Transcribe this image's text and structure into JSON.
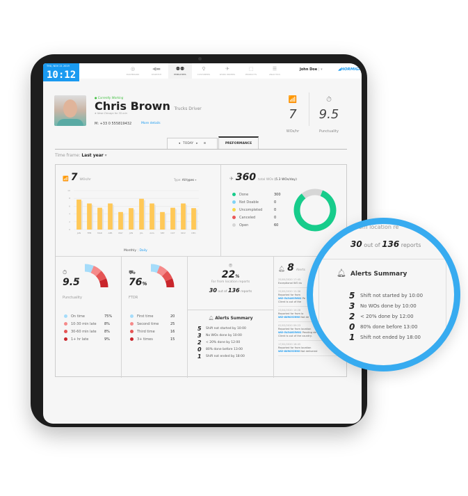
{
  "header": {
    "date": "THU, NOV 21 2019",
    "time": "10:12",
    "nav": [
      {
        "icon": "dashboard-icon",
        "glyph": "◎",
        "label": "DASHBOARD",
        "active": false
      },
      {
        "icon": "dispatch-icon",
        "glyph": "📢",
        "label": "DISPATCH",
        "active": false
      },
      {
        "icon": "employees-icon",
        "glyph": "👥",
        "label": "EMPLOYEES",
        "active": true
      },
      {
        "icon": "customers-icon",
        "glyph": "⚲",
        "label": "CUSTOMERS",
        "active": false
      },
      {
        "icon": "work-orders-icon",
        "glyph": "✈",
        "label": "WORK ORDERS",
        "active": false
      },
      {
        "icon": "products-icon",
        "glyph": "⬚",
        "label": "PRODUCTS",
        "active": false
      },
      {
        "icon": "analytics-icon",
        "glyph": "☰",
        "label": "ANALYTICS",
        "active": false
      }
    ],
    "user": "John Doe",
    "logo": "HORMIGA"
  },
  "profile": {
    "status": "Currently Working",
    "name": "Chris Brown",
    "role": "Trucks Driver",
    "location": "Near Chicago for 35 min",
    "phone": "M: +33 0 555819432",
    "more_details": "More details",
    "kpis": [
      {
        "icon": "growth-chart-icon",
        "value": "7",
        "label": "WOs/hr"
      },
      {
        "icon": "stopwatch-icon",
        "value": "9.5",
        "label": "Punctuality"
      }
    ]
  },
  "tabs": {
    "today": "TODAY",
    "performance": "PREFORMANCE"
  },
  "timeframe": {
    "label": "Time frame:",
    "value": "Last year"
  },
  "wos_per_hour": {
    "value": "7",
    "label": "WOs/hr",
    "type_label": "Type:",
    "type_value": "All types",
    "toggle": {
      "monthly": "Monthly",
      "daily": "Daily"
    }
  },
  "chart_data": {
    "type": "bar",
    "title": "WOs/hr",
    "categories": [
      "JAN",
      "FEB",
      "MAR",
      "APR",
      "MAY",
      "JUN",
      "JUL",
      "AUG",
      "SEP",
      "OCT",
      "NOV",
      "DEC"
    ],
    "values": [
      7.7,
      6.7,
      5.6,
      6.7,
      4.5,
      5.5,
      7.9,
      6.7,
      4.5,
      5.6,
      6.7,
      5.5
    ],
    "yticks": [
      0,
      2,
      4,
      6,
      8,
      10
    ],
    "ylim": [
      0,
      10
    ],
    "xlabel": "",
    "ylabel": "",
    "grid": true,
    "color": "#ffc857"
  },
  "total_wos": {
    "value": "360",
    "label": "total WOs",
    "rate": "(5.3 WOs/day)",
    "breakdown": [
      {
        "label": "Done",
        "value": 300,
        "color": "#17cc8b"
      },
      {
        "label": "Not Doable",
        "value": 0,
        "color": "#7fd3f5"
      },
      {
        "label": "Uncompleted",
        "value": 0,
        "color": "#f5d94a"
      },
      {
        "label": "Canceled",
        "value": 0,
        "color": "#e95757"
      },
      {
        "label": "Open",
        "value": 60,
        "color": "#d6d6d6"
      }
    ]
  },
  "punctuality": {
    "value": "9.5",
    "label": "Punctuality",
    "items": [
      {
        "label": "On time",
        "value": "75%",
        "color": "#a5dcfa"
      },
      {
        "label": "10-30 min late",
        "value": "8%",
        "color": "#f58a8a"
      },
      {
        "label": "30-60 min late",
        "value": "8%",
        "color": "#e55454"
      },
      {
        "label": "1+ hr late",
        "value": "9%",
        "color": "#c9262c"
      }
    ]
  },
  "ftdr": {
    "value": "76",
    "unit": "%",
    "label": "FTDR",
    "items": [
      {
        "label": "First time",
        "value": "20",
        "color": "#a5dcfa"
      },
      {
        "label": "Second time",
        "value": "25",
        "color": "#f58a8a"
      },
      {
        "label": "Third time",
        "value": "16",
        "color": "#e55454"
      },
      {
        "label": "3+ times",
        "value": "15",
        "color": "#c9262c"
      }
    ]
  },
  "location_reports": {
    "value": "22",
    "unit": "%",
    "label": "Far from location reports",
    "count": "30",
    "out_of": "out of",
    "total": "136",
    "reports": "reports"
  },
  "alerts_summary": {
    "title": "Alerts Summary",
    "items": [
      {
        "count": "5",
        "label": "Shift not started by 10:00"
      },
      {
        "count": "3",
        "label": "No WOs done by 10:00"
      },
      {
        "count": "2",
        "label": "< 20% done by 12:00"
      },
      {
        "count": "0",
        "label": "80% done before 13:00"
      },
      {
        "count": "1",
        "label": "Shift not ended by 18:00"
      }
    ]
  },
  "alerts_feed": {
    "count": "8",
    "label": "Alerts",
    "items": [
      {
        "time": "25/05/2020 17:45",
        "text": "Exceptional WO du",
        "wo": "",
        "extra": ""
      },
      {
        "time": "25/05/2020 12:36",
        "text": "Reported far from",
        "wo": "WO-5434835601",
        "status": "Pe",
        "extra": "Client is out of the"
      },
      {
        "time": "23/04/2020 10:28",
        "text": "Reported far from lo",
        "wo": "WO-889033690",
        "status": "Not de",
        "extra": ""
      },
      {
        "time": "02/03/2020 09:23",
        "text": "Reported far from location",
        "wo": "WO-5434835601",
        "status": "Pending de",
        "extra": "Client is out of the country."
      },
      {
        "time": "17/02/2020 18:45",
        "text": "Reported far from location",
        "wo": "WO-889033690",
        "status": "Not delivered",
        "extra": ""
      }
    ]
  },
  "magnifier": {
    "location_text": "from location re",
    "side_texts": [
      "Re",
      "WO",
      "02/0",
      "Rep",
      "WO-",
      "Clie",
      "17"
    ]
  }
}
